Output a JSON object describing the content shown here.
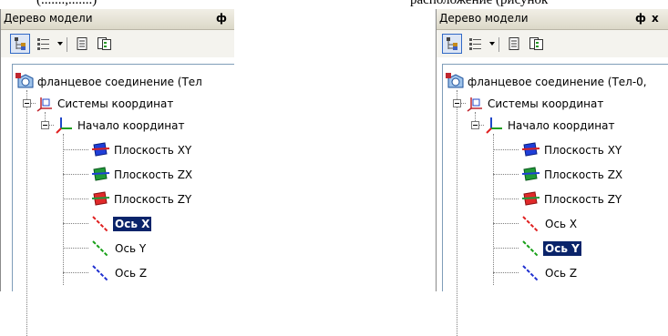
{
  "doc_text": {
    "left_fragment": "(.......,.......)",
    "middle_fragment": "расположение (рисунок"
  },
  "panels": [
    {
      "title": "Дерево модели",
      "pin": "ф",
      "tree": {
        "root": "фланцевое соединение (Тел",
        "coord_systems": "Системы координат",
        "origin": "Начало координат",
        "planes": [
          "Плоскость XY",
          "Плоскость ZX",
          "Плоскость ZY"
        ],
        "axes": [
          "Ось X",
          "Ось Y",
          "Ось Z"
        ],
        "selected_axis": "Ось X"
      }
    },
    {
      "title": "Дерево модели",
      "pin": "ф",
      "close": "x",
      "tree": {
        "root": "фланцевое соединение (Тел-0,",
        "coord_systems": "Системы координат",
        "origin": "Начало координат",
        "planes": [
          "Плоскость XY",
          "Плоскость ZX",
          "Плоскость ZY"
        ],
        "axes": [
          "Ось X",
          "Ось Y",
          "Ось Z"
        ],
        "selected_axis": "Ось Y"
      }
    }
  ],
  "icons": [
    "tree-structure-icon",
    "tree-filter-icon",
    "document-icon",
    "document-list-icon",
    "part-icon",
    "coordinate-system-icon",
    "origin-icon",
    "plane-xy-icon",
    "plane-zx-icon",
    "plane-zy-icon",
    "axis-x-icon",
    "axis-y-icon",
    "axis-z-icon"
  ],
  "colors": {
    "selection": "#0a246a",
    "axis_x": "#e02020",
    "axis_y": "#18a018",
    "axis_z": "#2030d0",
    "plane_xy": "#1f3fd8",
    "plane_zx": "#1f9a3a",
    "plane_zy": "#e02a2a"
  }
}
